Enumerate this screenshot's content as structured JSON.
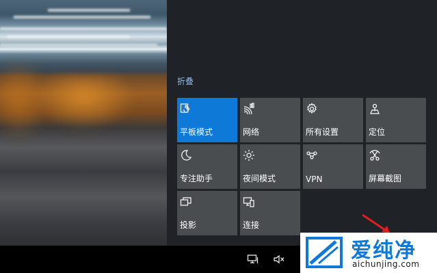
{
  "action_center": {
    "collapse_label": "折叠",
    "tiles": [
      {
        "label": "平板模式",
        "icon": "tablet-mode-icon",
        "active": true
      },
      {
        "label": "网络",
        "icon": "network-icon",
        "active": false
      },
      {
        "label": "所有设置",
        "icon": "settings-gear-icon",
        "active": false
      },
      {
        "label": "定位",
        "icon": "location-icon",
        "active": false
      },
      {
        "label": "专注助手",
        "icon": "moon-icon",
        "active": false
      },
      {
        "label": "夜间模式",
        "icon": "sun-icon",
        "active": false
      },
      {
        "label": "VPN",
        "icon": "vpn-icon",
        "active": false
      },
      {
        "label": "屏幕截图",
        "icon": "screen-snip-icon",
        "active": false
      },
      {
        "label": "投影",
        "icon": "project-icon",
        "active": false
      },
      {
        "label": "连接",
        "icon": "connect-icon",
        "active": false
      }
    ]
  },
  "taskbar": {
    "icons": [
      "network-tray-icon",
      "volume-muted-icon"
    ]
  },
  "watermark": {
    "brand_cn": "爱纯净",
    "url": "aichunjing.com"
  },
  "colors": {
    "accent": "#0f79d8",
    "tile": "#4a4d50",
    "panel": "#1f2226",
    "link": "#8fb8e6"
  }
}
